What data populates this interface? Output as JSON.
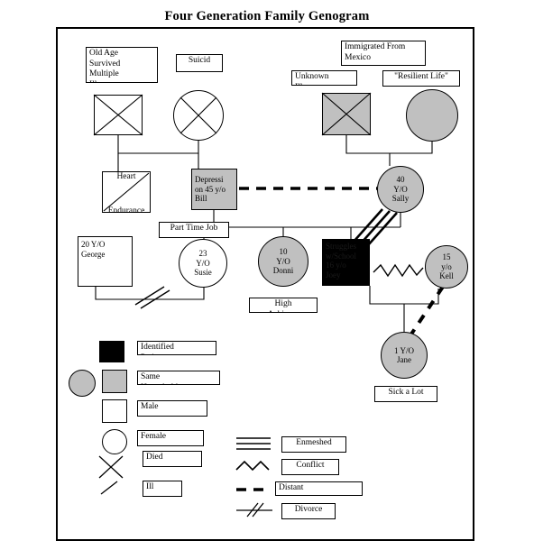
{
  "title": "Four Generation Family Genogram",
  "nodes": [
    {
      "id": "gen1-male",
      "label": "",
      "shape": "square",
      "fill": "white",
      "marks": [
        "died-x"
      ]
    },
    {
      "id": "gen1-female",
      "label": "",
      "shape": "circle",
      "fill": "white",
      "marks": [
        "died-x"
      ]
    },
    {
      "id": "heart-uncle",
      "label": "",
      "shape": "square",
      "fill": "white",
      "marks": [
        "ill-slash"
      ]
    },
    {
      "id": "bill",
      "label": "Depression 45 y/o Bill",
      "shape": "square",
      "fill": "gray"
    },
    {
      "id": "mex-male",
      "label": "",
      "shape": "square",
      "fill": "gray",
      "marks": [
        "died-x"
      ]
    },
    {
      "id": "mex-female",
      "label": "",
      "shape": "circle",
      "fill": "gray"
    },
    {
      "id": "sally",
      "label": "40 Y/O Sally",
      "shape": "circle",
      "fill": "gray"
    },
    {
      "id": "george",
      "label": "20 Y/O George",
      "shape": "square",
      "fill": "white"
    },
    {
      "id": "susie",
      "label": "23 Y/O Susie",
      "shape": "circle",
      "fill": "white"
    },
    {
      "id": "donni",
      "label": "10 Y/O Donni",
      "shape": "circle",
      "fill": "gray"
    },
    {
      "id": "joey",
      "label": "Struggles w/School 16 y/o Joey",
      "shape": "square",
      "fill": "black"
    },
    {
      "id": "kell",
      "label": "15 y/o Kell",
      "shape": "circle",
      "fill": "gray"
    },
    {
      "id": "jane",
      "label": "1 Y/O Jane",
      "shape": "circle",
      "fill": "gray"
    }
  ],
  "node_text": {
    "bill_l1": "Depressi",
    "bill_l2": "on 45 y/o",
    "bill_l3": "Bill",
    "sally_l1": "40",
    "sally_l2": "Y/O",
    "sally_l3": "Sally",
    "george_l1": "20 Y/O",
    "george_l2": "George",
    "susie_l1": "23",
    "susie_l2": "Y/O",
    "susie_l3": "Susie",
    "donni_l1": "10",
    "donni_l2": "Y/O",
    "donni_l3": "Donni",
    "joey_l1": "Struggles",
    "joey_l2": "w/School",
    "joey_l3": "16 y/o",
    "joey_l4": "Joey",
    "kell_l1": "15",
    "kell_l2": "y/o",
    "kell_l3": "Kell",
    "jane_l1": "1 Y/O",
    "jane_l2": "Jane"
  },
  "notes": {
    "old_age": "Old Age\nSurvived\nMultiple\nIllnesses",
    "suicide": "Suicid",
    "immigrated": "Immigrated From\nMexico",
    "unknown_illness": "Unknown\nIllness",
    "resilient": "\"Resilient Life\"",
    "heart": "Heart\n\nEndurance",
    "part_time_job": "Part Time Job",
    "high_achiever": "High\nAchiever",
    "sick_a_lot": "Sick a Lot"
  },
  "legend_symbols": {
    "heading_items": [
      {
        "key": "identified",
        "label": "Identified\nPatient",
        "swatch": "black-square"
      },
      {
        "key": "same",
        "label": "Same\nHousehold",
        "swatch": "gray-circle-square"
      },
      {
        "key": "male",
        "label": "Male",
        "swatch": "white-square"
      },
      {
        "key": "female",
        "label": "Female",
        "swatch": "white-circle"
      },
      {
        "key": "died",
        "label": "Died",
        "swatch": "x-mark"
      },
      {
        "key": "ill",
        "label": "Ill",
        "swatch": "slash-mark"
      }
    ]
  },
  "legend_relations": {
    "items": [
      {
        "key": "enmeshed",
        "label": "Enmeshed",
        "swatch": "triple-line"
      },
      {
        "key": "conflict",
        "label": "Conflict",
        "swatch": "zigzag-line"
      },
      {
        "key": "distant",
        "label": "Distant",
        "swatch": "dashed-line"
      },
      {
        "key": "divorce",
        "label": "Divorce",
        "swatch": "double-slash-line"
      }
    ]
  },
  "colors": {
    "stroke": "#000000",
    "gray_fill": "#c0c0c0",
    "black_fill": "#000000",
    "white_fill": "#ffffff",
    "background": "#ffffff"
  }
}
